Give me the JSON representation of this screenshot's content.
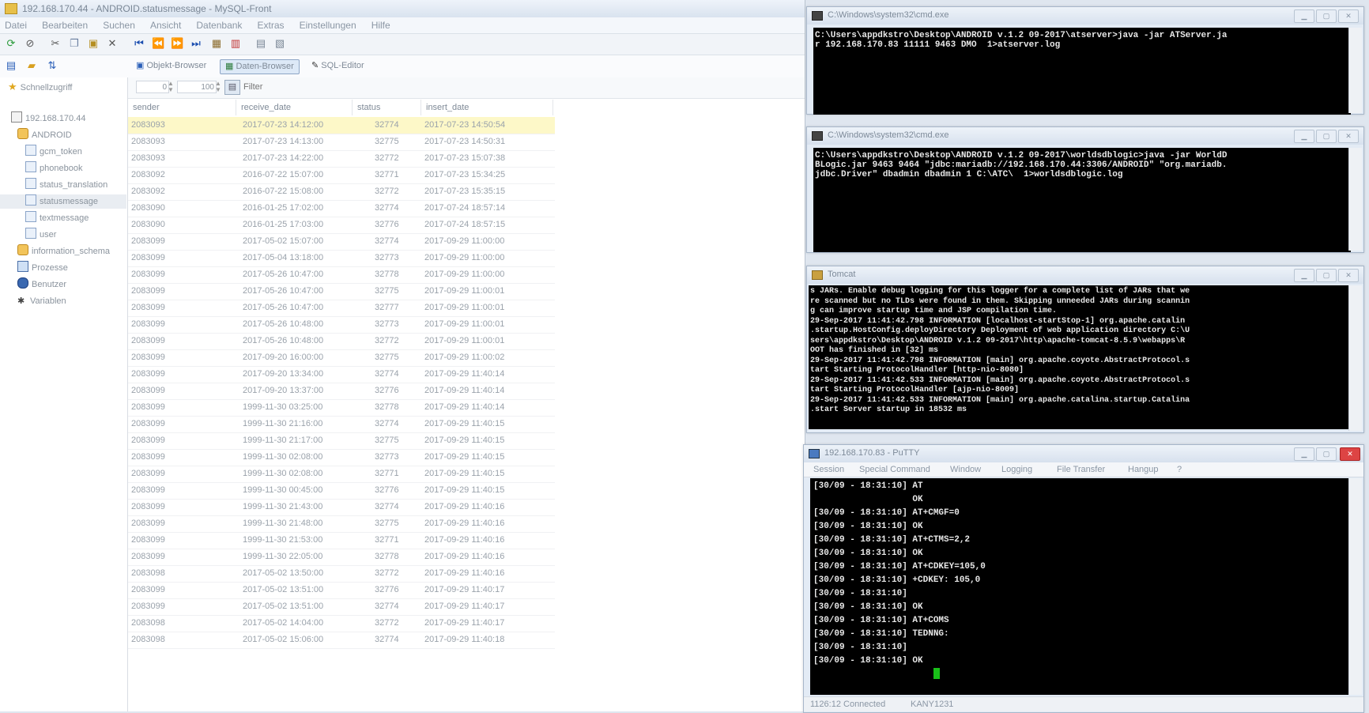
{
  "mysqlfront": {
    "title": "192.168.170.44 - ANDROID.statusmessage - MySQL-Front",
    "menu": [
      "Datei",
      "Bearbeiten",
      "Suchen",
      "Ansicht",
      "Datenbank",
      "Extras",
      "Einstellungen",
      "Hilfe"
    ],
    "views": {
      "object_browser": "Objekt-Browser",
      "data_browser": "Daten-Browser",
      "sql_editor": "SQL-Editor"
    },
    "tree": {
      "quick_access": "Schnellzugriff",
      "host": "192.168.170.44",
      "database": "ANDROID",
      "tables": [
        "gcm_token",
        "phonebook",
        "status_translation",
        "statusmessage",
        "textmessage",
        "user"
      ],
      "info_schema": "information_schema",
      "processes": "Prozesse",
      "users": "Benutzer",
      "variables": "Variablen"
    },
    "filter": {
      "offset": "0",
      "limit": "100",
      "placeholder": "Filter"
    },
    "columns": [
      "sender",
      "receive_date",
      "status",
      "insert_date"
    ],
    "rows": [
      [
        "2083093",
        "2017-07-23 14:12:00",
        "32774",
        "2017-07-23 14:50:54"
      ],
      [
        "2083093",
        "2017-07-23 14:13:00",
        "32775",
        "2017-07-23 14:50:31"
      ],
      [
        "2083093",
        "2017-07-23 14:22:00",
        "32772",
        "2017-07-23 15:07:38"
      ],
      [
        "2083092",
        "2016-07-22 15:07:00",
        "32771",
        "2017-07-23 15:34:25"
      ],
      [
        "2083092",
        "2016-07-22 15:08:00",
        "32772",
        "2017-07-23 15:35:15"
      ],
      [
        "2083090",
        "2016-01-25 17:02:00",
        "32774",
        "2017-07-24 18:57:14"
      ],
      [
        "2083090",
        "2016-01-25 17:03:00",
        "32776",
        "2017-07-24 18:57:15"
      ],
      [
        "2083099",
        "2017-05-02 15:07:00",
        "32774",
        "2017-09-29 11:00:00"
      ],
      [
        "2083099",
        "2017-05-04 13:18:00",
        "32773",
        "2017-09-29 11:00:00"
      ],
      [
        "2083099",
        "2017-05-26 10:47:00",
        "32778",
        "2017-09-29 11:00:00"
      ],
      [
        "2083099",
        "2017-05-26 10:47:00",
        "32775",
        "2017-09-29 11:00:01"
      ],
      [
        "2083099",
        "2017-05-26 10:47:00",
        "32777",
        "2017-09-29 11:00:01"
      ],
      [
        "2083099",
        "2017-05-26 10:48:00",
        "32773",
        "2017-09-29 11:00:01"
      ],
      [
        "2083099",
        "2017-05-26 10:48:00",
        "32772",
        "2017-09-29 11:00:01"
      ],
      [
        "2083099",
        "2017-09-20 16:00:00",
        "32775",
        "2017-09-29 11:00:02"
      ],
      [
        "2083099",
        "2017-09-20 13:34:00",
        "32774",
        "2017-09-29 11:40:14"
      ],
      [
        "2083099",
        "2017-09-20 13:37:00",
        "32776",
        "2017-09-29 11:40:14"
      ],
      [
        "2083099",
        "1999-11-30 03:25:00",
        "32778",
        "2017-09-29 11:40:14"
      ],
      [
        "2083099",
        "1999-11-30 21:16:00",
        "32774",
        "2017-09-29 11:40:15"
      ],
      [
        "2083099",
        "1999-11-30 21:17:00",
        "32775",
        "2017-09-29 11:40:15"
      ],
      [
        "2083099",
        "1999-11-30 02:08:00",
        "32773",
        "2017-09-29 11:40:15"
      ],
      [
        "2083099",
        "1999-11-30 02:08:00",
        "32771",
        "2017-09-29 11:40:15"
      ],
      [
        "2083099",
        "1999-11-30 00:45:00",
        "32776",
        "2017-09-29 11:40:15"
      ],
      [
        "2083099",
        "1999-11-30 21:43:00",
        "32774",
        "2017-09-29 11:40:16"
      ],
      [
        "2083099",
        "1999-11-30 21:48:00",
        "32775",
        "2017-09-29 11:40:16"
      ],
      [
        "2083099",
        "1999-11-30 21:53:00",
        "32771",
        "2017-09-29 11:40:16"
      ],
      [
        "2083099",
        "1999-11-30 22:05:00",
        "32778",
        "2017-09-29 11:40:16"
      ],
      [
        "2083098",
        "2017-05-02 13:50:00",
        "32772",
        "2017-09-29 11:40:16"
      ],
      [
        "2083099",
        "2017-05-02 13:51:00",
        "32776",
        "2017-09-29 11:40:17"
      ],
      [
        "2083099",
        "2017-05-02 13:51:00",
        "32774",
        "2017-09-29 11:40:17"
      ],
      [
        "2083098",
        "2017-05-02 14:04:00",
        "32772",
        "2017-09-29 11:40:17"
      ],
      [
        "2083098",
        "2017-05-02 15:06:00",
        "32774",
        "2017-09-29 11:40:18"
      ]
    ]
  },
  "cmd1": {
    "title": "C:\\Windows\\system32\\cmd.exe",
    "lines": [
      "C:\\Users\\appdkstro\\Desktop\\ANDROID v.1.2 09-2017\\atserver>java -jar ATServer.ja",
      "r 192.168.170.83 11111 9463 DMO  1>atserver.log"
    ]
  },
  "cmd2": {
    "title": "C:\\Windows\\system32\\cmd.exe",
    "lines": [
      "C:\\Users\\appdkstro\\Desktop\\ANDROID v.1.2 09-2017\\worldsdblogic>java -jar WorldD",
      "BLogic.jar 9463 9464 \"jdbc:mariadb://192.168.170.44:3306/ANDROID\" \"org.mariadb.",
      "jdbc.Driver\" dbadmin dbadmin 1 C:\\ATC\\  1>worldsdblogic.log"
    ]
  },
  "tomcat": {
    "title": "Tomcat",
    "lines": [
      "s JARs. Enable debug logging for this logger for a complete list of JARs that we",
      "re scanned but no TLDs were found in them. Skipping unneeded JARs during scannin",
      "g can improve startup time and JSP compilation time.",
      "29-Sep-2017 11:41:42.798 INFORMATION [localhost-startStop-1] org.apache.catalin",
      ".startup.HostConfig.deployDirectory Deployment of web application directory C:\\U",
      "sers\\appdkstro\\Desktop\\ANDROID v.1.2 09-2017\\http\\apache-tomcat-8.5.9\\webapps\\R",
      "OOT has finished in [32] ms",
      "29-Sep-2017 11:41:42.798 INFORMATION [main] org.apache.coyote.AbstractProtocol.s",
      "tart Starting ProtocolHandler [http-nio-8080]",
      "29-Sep-2017 11:41:42.533 INFORMATION [main] org.apache.coyote.AbstractProtocol.s",
      "tart Starting ProtocolHandler [ajp-nio-8009]",
      "29-Sep-2017 11:41:42.533 INFORMATION [main] org.apache.catalina.startup.Catalina",
      ".start Server startup in 18532 ms"
    ]
  },
  "putty": {
    "title": "192.168.170.83 - PuTTY",
    "menu": [
      "Session",
      "Special Command",
      "Window",
      "Logging",
      "File Transfer",
      "Hangup",
      "?"
    ],
    "lines": [
      "[30/09 - 18:31:10] AT",
      "                   OK",
      "[30/09 - 18:31:10] AT+CMGF=0",
      "[30/09 - 18:31:10] OK",
      "[30/09 - 18:31:10] AT+CTMS=2,2",
      "[30/09 - 18:31:10] OK",
      "[30/09 - 18:31:10] AT+CDKEY=105,0",
      "[30/09 - 18:31:10] +CDKEY: 105,0",
      "[30/09 - 18:31:10]",
      "[30/09 - 18:31:10] OK",
      "[30/09 - 18:31:10] AT+COMS",
      "[30/09 - 18:31:10] TEDNNG:",
      "[30/09 - 18:31:10]",
      "[30/09 - 18:31:10] OK"
    ],
    "status_left": "1126:12 Connected",
    "status_right": "KANY1231"
  }
}
